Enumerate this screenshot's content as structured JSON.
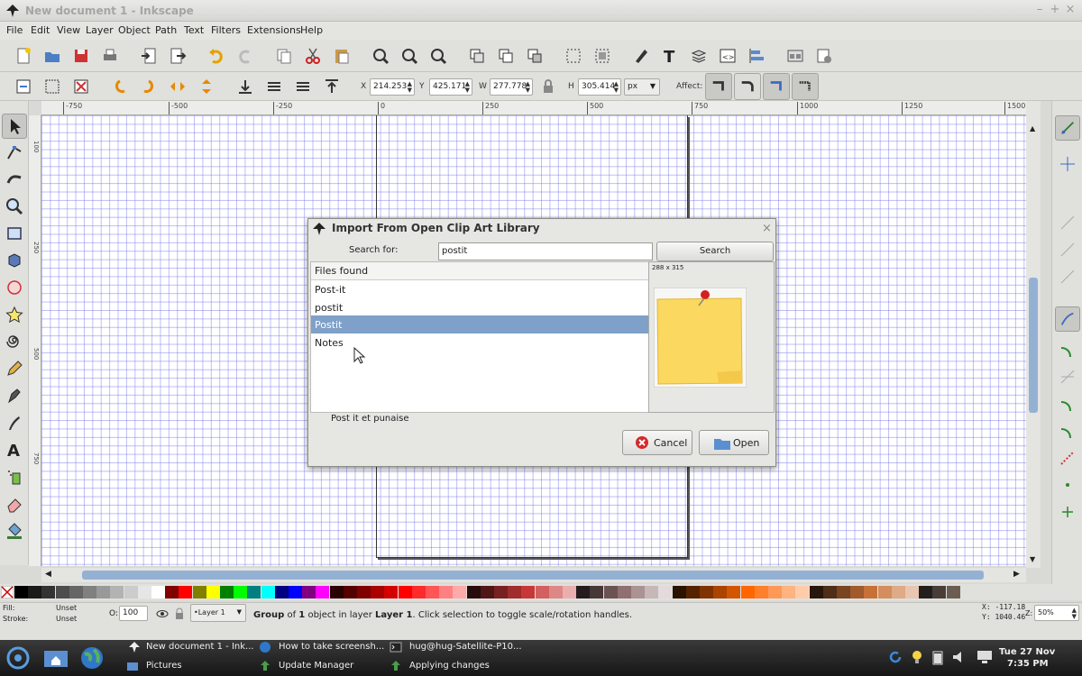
{
  "window": {
    "title": "New document 1 - Inkscape",
    "controls": {
      "minimize": "–",
      "maximize": "+",
      "close": "×"
    }
  },
  "menu": [
    "File",
    "Edit",
    "View",
    "Layer",
    "Object",
    "Path",
    "Text",
    "Filters",
    "Extensions",
    "Help"
  ],
  "toolbar2": {
    "x_label": "X",
    "x_value": "214.253",
    "y_label": "Y",
    "y_value": "425.171",
    "w_label": "W",
    "w_value": "277.778",
    "h_label": "H",
    "h_value": "305.414",
    "unit": "px",
    "affect_label": "Affect:"
  },
  "ruler_h": [
    "-750",
    "-500",
    "-250",
    "0",
    "250",
    "500",
    "750",
    "1000",
    "1250",
    "1500"
  ],
  "ruler_v": [
    "100",
    "250",
    "500",
    "750"
  ],
  "dialog": {
    "title": "Import From Open Clip Art Library",
    "search_label": "Search for:",
    "search_value": "postit",
    "search_button": "Search",
    "files_header": "Files found",
    "files": [
      "Post-it",
      "postit",
      "Postit",
      "Notes"
    ],
    "selected_index": 2,
    "preview_size": "288 x 315",
    "description": "Post it et punaise",
    "cancel": "Cancel",
    "open": "Open"
  },
  "status": {
    "fill_label": "Fill:",
    "fill_value": "Unset",
    "stroke_label": "Stroke:",
    "stroke_value": "Unset",
    "opacity_label": "O:",
    "opacity_value": "100",
    "layer": "•Layer 1",
    "message_bold1": "Group",
    "message_mid1": " of ",
    "message_bold2": "1",
    "message_mid2": " object in layer ",
    "message_bold3": "Layer 1",
    "message_tail": ". Click selection to toggle scale/rotation handles.",
    "coords_x": "X: -117.18",
    "coords_y": "Y: 1040.46",
    "zoom_label": "Z:",
    "zoom_value": "50%"
  },
  "taskbar": {
    "tasks_top": [
      "New document 1 - Ink...",
      "How to take screensh...",
      "hug@hug-Satellite-P10..."
    ],
    "tasks_bottom": [
      "Pictures",
      "Update Manager",
      "Applying changes"
    ],
    "clock_date": "Tue 27 Nov",
    "clock_time": "7:35 PM"
  },
  "colors": {
    "accent": "#7fa0c8",
    "grid": "#6e6eeb",
    "postit": "#fbd85f"
  }
}
